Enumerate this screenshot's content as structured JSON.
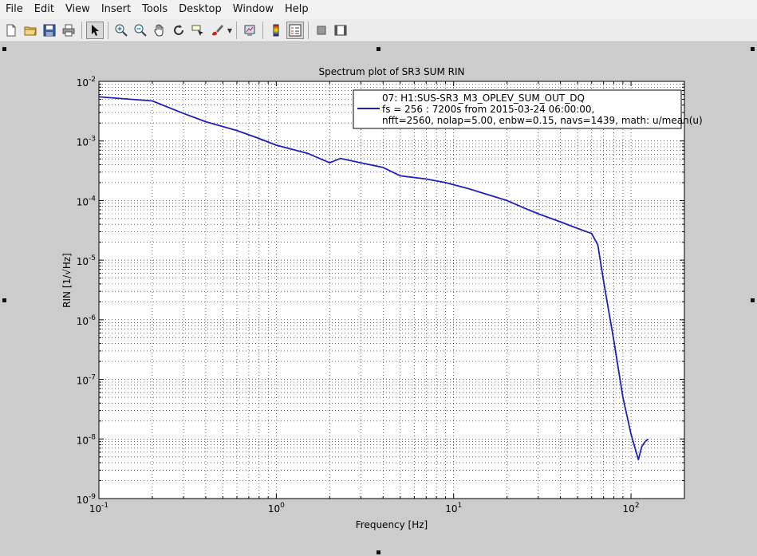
{
  "menu": [
    "File",
    "Edit",
    "View",
    "Insert",
    "Tools",
    "Desktop",
    "Window",
    "Help"
  ],
  "toolbar": {
    "buttons": [
      "new-figure-icon",
      "open-file-icon",
      "save-icon",
      "print-icon",
      "select-arrow-icon",
      "zoom-in-icon",
      "zoom-out-icon",
      "pan-hand-icon",
      "rotate-3d-icon",
      "data-cursor-icon",
      "brush-icon",
      "link-plot-icon",
      "colorbar-icon",
      "legend-icon",
      "hide-plot-tools-icon",
      "show-plot-tools-icon"
    ]
  },
  "chart_data": {
    "type": "line",
    "title": "Spectrum plot of SR3 SUM RIN",
    "xlabel": "Frequency [Hz]",
    "ylabel": "RIN [1/√Hz]",
    "xscale": "log",
    "yscale": "log",
    "xlim": [
      0.1,
      200
    ],
    "ylim": [
      1e-09,
      0.01
    ],
    "grid": true,
    "legend_placement": "top-right",
    "line_color": "#2020b8",
    "x_tick_labels": [
      {
        "base": "10",
        "exp": "-1"
      },
      {
        "base": "10",
        "exp": "0"
      },
      {
        "base": "10",
        "exp": "1"
      },
      {
        "base": "10",
        "exp": "2"
      }
    ],
    "y_tick_labels": [
      {
        "base": "10",
        "exp": "-9"
      },
      {
        "base": "10",
        "exp": "-8"
      },
      {
        "base": "10",
        "exp": "-7"
      },
      {
        "base": "10",
        "exp": "-6"
      },
      {
        "base": "10",
        "exp": "-5"
      },
      {
        "base": "10",
        "exp": "-4"
      },
      {
        "base": "10",
        "exp": "-3"
      },
      {
        "base": "10",
        "exp": "-2"
      }
    ],
    "legend": {
      "title": "07: H1:SUS-SR3_M3_OPLEV_SUM_OUT_DQ",
      "lines": [
        "fs = 256 : 7200s from 2015-03-24 06:00:00,",
        "nfft=2560, nolap=5.00, enbw=0.15, navs=1439, math: u/mean(u)"
      ]
    },
    "series": [
      {
        "x": [
          0.1,
          0.2,
          0.3,
          0.4,
          0.6,
          0.8,
          1.0,
          1.5,
          2.0,
          2.3,
          3.0,
          4.0,
          5.0,
          7.0,
          9.0,
          12,
          15,
          20,
          25,
          30,
          40,
          50,
          60,
          65,
          70,
          80,
          90,
          100,
          110,
          115,
          120,
          125
        ],
        "y": [
          0.0055,
          0.0047,
          0.0029,
          0.0021,
          0.0015,
          0.0011,
          0.00085,
          0.00062,
          0.00043,
          0.00051,
          0.00043,
          0.00036,
          0.00026,
          0.00023,
          0.0002,
          0.00016,
          0.00013,
          0.0001,
          7.5e-05,
          6e-05,
          4.4e-05,
          3.4e-05,
          2.8e-05,
          1.8e-05,
          4.5e-06,
          4.5e-07,
          5e-08,
          1.2e-08,
          4.5e-09,
          7.5e-09,
          9e-09,
          1e-08
        ]
      }
    ]
  }
}
